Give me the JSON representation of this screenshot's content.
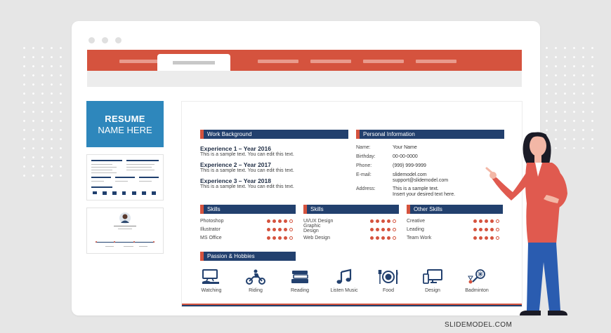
{
  "thumbnails": {
    "cover_title": "RESUME",
    "cover_subtitle": "NAME HERE"
  },
  "resume": {
    "work": {
      "heading": "Work Background",
      "items": [
        {
          "title": "Experience 1 – Year 2016",
          "text": "This is a sample text. You can edit this text."
        },
        {
          "title": "Experience 2 – Year 2017",
          "text": "This is a sample text. You can edit this text."
        },
        {
          "title": "Experience 3 – Year 2018",
          "text": "This is a sample text. You can edit this text."
        }
      ]
    },
    "personal": {
      "heading": "Personal Information",
      "rows": [
        {
          "label": "Name:",
          "value": "Your Name"
        },
        {
          "label": "Birthday:",
          "value": "00-00-0000"
        },
        {
          "label": "Phone:",
          "value": "(999) 999-9999"
        },
        {
          "label": "E-mail:",
          "value": "slidemodel.com\nsupport@slidemodel.com"
        },
        {
          "label": "Address:",
          "value": "This is a sample text.\nInsert your desired text here."
        }
      ]
    },
    "skill_groups": [
      {
        "heading": "Skills",
        "items": [
          {
            "name": "Photoshop",
            "level": 4
          },
          {
            "name": "Illustrator",
            "level": 4
          },
          {
            "name": "MS Office",
            "level": 4
          }
        ]
      },
      {
        "heading": "Skills",
        "items": [
          {
            "name": "UI/UX Design",
            "level": 4
          },
          {
            "name": "Graphic\nDesign",
            "level": 4
          },
          {
            "name": "Web Design",
            "level": 4
          }
        ]
      },
      {
        "heading": "Other Skills",
        "items": [
          {
            "name": "Creative",
            "level": 4
          },
          {
            "name": "Leading",
            "level": 4
          },
          {
            "name": "Team Work",
            "level": 4
          }
        ]
      }
    ],
    "rating_max": 5,
    "hobbies": {
      "heading": "Passion & Hobbies",
      "items": [
        {
          "label": "Watching",
          "icon": "tv-icon"
        },
        {
          "label": "Riding",
          "icon": "motorbike-icon"
        },
        {
          "label": "Reading",
          "icon": "books-icon"
        },
        {
          "label": "Listen Music",
          "icon": "music-note-icon"
        },
        {
          "label": "Food",
          "icon": "plate-cutlery-icon"
        },
        {
          "label": "Design",
          "icon": "computer-icon"
        },
        {
          "label": "Badminton",
          "icon": "badminton-icon"
        }
      ]
    }
  },
  "brand": "SLIDEMODEL.COM",
  "colors": {
    "accent_red": "#d5533e",
    "navy": "#22406e",
    "cover_blue": "#2e87bc"
  }
}
